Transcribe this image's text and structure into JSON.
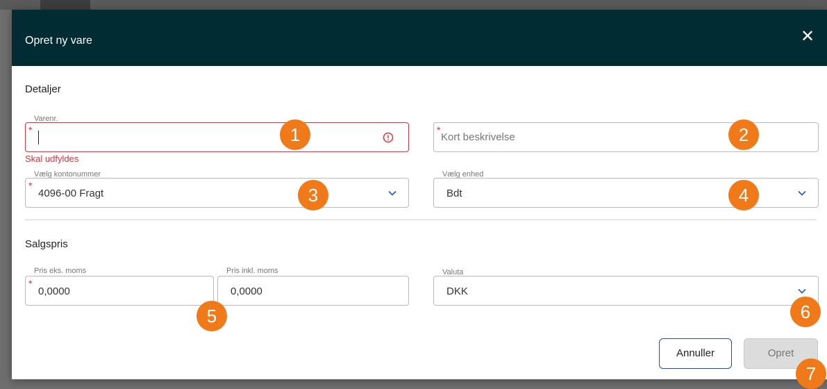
{
  "dialog": {
    "title": "Opret ny vare",
    "close_icon": "close-icon"
  },
  "details": {
    "section_title": "Detaljer",
    "item_number": {
      "label": "Varenr.",
      "required_marker": "*",
      "value": "",
      "error": "Skal udfyldes",
      "error_icon": "alert-circle-icon"
    },
    "short_description": {
      "required_marker": "*",
      "placeholder": "Kort beskrivelse"
    },
    "account": {
      "label": "Vælg kontonummer",
      "required_marker": "*",
      "value": "4096-00 Fragt"
    },
    "unit": {
      "label": "Vælg enhed",
      "value": "Bdt"
    }
  },
  "sales_price": {
    "section_title": "Salgspris",
    "price_excl": {
      "label": "Pris eks. moms",
      "required_marker": "*",
      "value": "0,0000"
    },
    "price_incl": {
      "label": "Pris inkl. moms",
      "value": "0,0000"
    },
    "currency": {
      "label": "Valuta",
      "value": "DKK"
    }
  },
  "actions": {
    "cancel_label": "Annuller",
    "create_label": "Opret"
  },
  "badges": [
    "1",
    "2",
    "3",
    "4",
    "5",
    "6",
    "7"
  ],
  "colors": {
    "header_bg": "#022c33",
    "error": "#e0313f",
    "badge": "#f07a1a",
    "primary_border": "#1f4fa3",
    "chevron": "#2a5bd7"
  }
}
